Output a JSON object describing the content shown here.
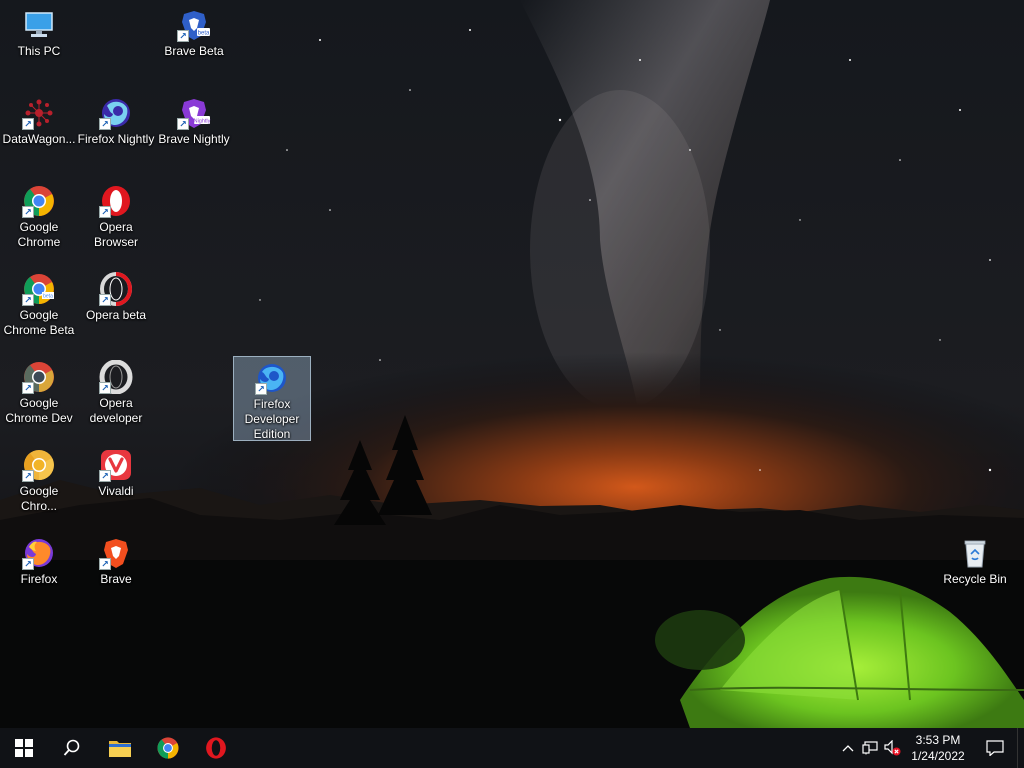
{
  "desktop": {
    "icons": [
      {
        "label": "This PC",
        "icon": "this-pc-icon"
      },
      {
        "label": "Brave Beta",
        "icon": "brave-beta-icon"
      },
      {
        "label": "DataWagon...",
        "icon": "datawagon-icon"
      },
      {
        "label": "Firefox Nightly",
        "icon": "firefox-nightly-icon"
      },
      {
        "label": "Brave Nightly",
        "icon": "brave-nightly-icon"
      },
      {
        "label": "Google Chrome",
        "icon": "google-chrome-icon"
      },
      {
        "label": "Opera Browser",
        "icon": "opera-icon"
      },
      {
        "label": "Google Chrome Beta",
        "icon": "chrome-beta-icon"
      },
      {
        "label": "Opera beta",
        "icon": "opera-beta-icon"
      },
      {
        "label": "Google Chrome Dev",
        "icon": "chrome-dev-icon"
      },
      {
        "label": "Opera developer",
        "icon": "opera-developer-icon"
      },
      {
        "label": "Firefox Developer Edition",
        "icon": "firefox-developer-icon"
      },
      {
        "label": "Google Chro...",
        "icon": "chrome-canary-icon"
      },
      {
        "label": "Vivaldi",
        "icon": "vivaldi-icon"
      },
      {
        "label": "Firefox",
        "icon": "firefox-icon"
      },
      {
        "label": "Brave",
        "icon": "brave-icon"
      },
      {
        "label": "Recycle Bin",
        "icon": "recycle-bin-icon"
      }
    ],
    "selected_icon": "Firefox Developer Edition"
  },
  "taskbar": {
    "pinned": [
      "start-icon",
      "search-icon",
      "file-explorer-icon",
      "google-chrome-icon",
      "opera-icon"
    ],
    "tray": {
      "clock_time": "3:53 PM",
      "clock_date": "1/24/2022"
    }
  },
  "colors": {
    "taskbar_bg": "#101216",
    "selection": "#aac8e6",
    "tent_green": "#7ad324"
  }
}
